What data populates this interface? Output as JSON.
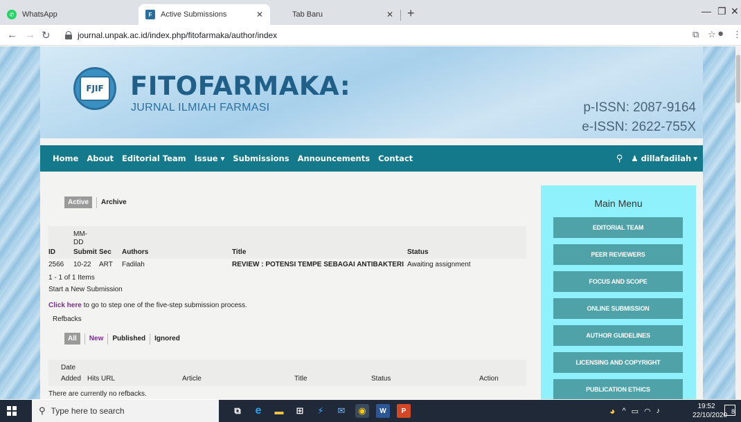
{
  "browser": {
    "tabs": [
      {
        "label": "WhatsApp",
        "active": false
      },
      {
        "label": "Active Submissions",
        "active": true
      },
      {
        "label": "Tab Baru",
        "active": false
      }
    ],
    "url": "journal.unpak.ac.id/index.php/fitofarmaka/author/index"
  },
  "site": {
    "title": "FITOFARMAKA:",
    "subtitle": "JURNAL ILMIAH FARMASI",
    "logo_text": "FJIF",
    "p_issn": "p-ISSN: 2087-9164",
    "e_issn": "e-ISSN: 2622-755X"
  },
  "nav": {
    "items": [
      "Home",
      "About",
      "Editorial Team",
      "Issue ▾",
      "Submissions",
      "Announcements",
      "Contact"
    ],
    "user": "dillafadilah"
  },
  "submissions": {
    "tabs": [
      "Active",
      "Archive"
    ],
    "headers": {
      "id": "ID",
      "date": "MM-\nDD",
      "submit": "Submit",
      "sec": "Sec",
      "authors": "Authors",
      "title": "Title",
      "status": "Status"
    },
    "rows": [
      {
        "id": "2566",
        "date": "10-22",
        "sec": "ART",
        "authors": "Fadilah",
        "title": "REVIEW : POTENSI TEMPE SEBAGAI ANTIBAKTERI",
        "status": "Awaiting assignment"
      }
    ],
    "count": "1 - 1 of 1 Items",
    "new_heading": "Start a New Submission",
    "click_here": "Click here",
    "click_rest": " to go to step one of the five-step submission process."
  },
  "refbacks": {
    "heading": "Refbacks",
    "filters": [
      "All",
      "New",
      "Published",
      "Ignored"
    ],
    "headers": {
      "date": "Date",
      "added": "Added",
      "hits": "Hits",
      "url": "URL",
      "article": "Article",
      "title": "Title",
      "status": "Status",
      "action": "Action"
    },
    "empty": "There are currently no refbacks."
  },
  "sidebar": {
    "title": "Main Menu",
    "items": [
      "EDITORIAL TEAM",
      "PEER REVIEWERS",
      "FOCUS AND SCOPE",
      "ONLINE SUBMISSION",
      "AUTHOR GUIDELINES",
      "LICENSING AND COPYRIGHT",
      "PUBLICATION ETHICS"
    ]
  },
  "taskbar": {
    "search_placeholder": "Type here to search",
    "time": "19:52",
    "date": "22/10/2020",
    "notif": "8"
  },
  "colors": {
    "navbar": "#14798a",
    "sidebar": "#8ef1fb",
    "menu_button": "#4fa3a8",
    "link": "#7b2d8e"
  }
}
